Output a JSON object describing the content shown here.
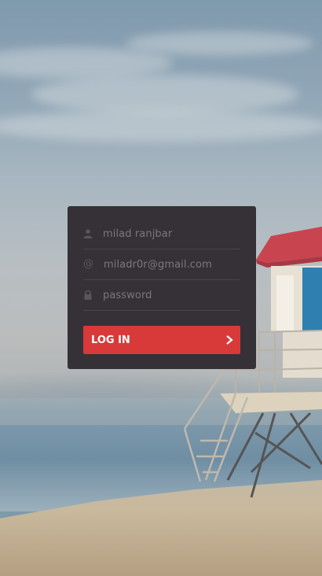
{
  "form": {
    "name_value": "milad ranjbar",
    "email_value": "miladr0r@gmail.com",
    "password_placeholder": "password",
    "login_label": "LOG IN"
  },
  "icons": {
    "name": "user-icon",
    "email": "at-icon",
    "password": "lock-icon",
    "button": "chevron-right-icon"
  },
  "colors": {
    "panel": "#353136",
    "button": "#d83a3a",
    "input_text": "#7d777c"
  }
}
